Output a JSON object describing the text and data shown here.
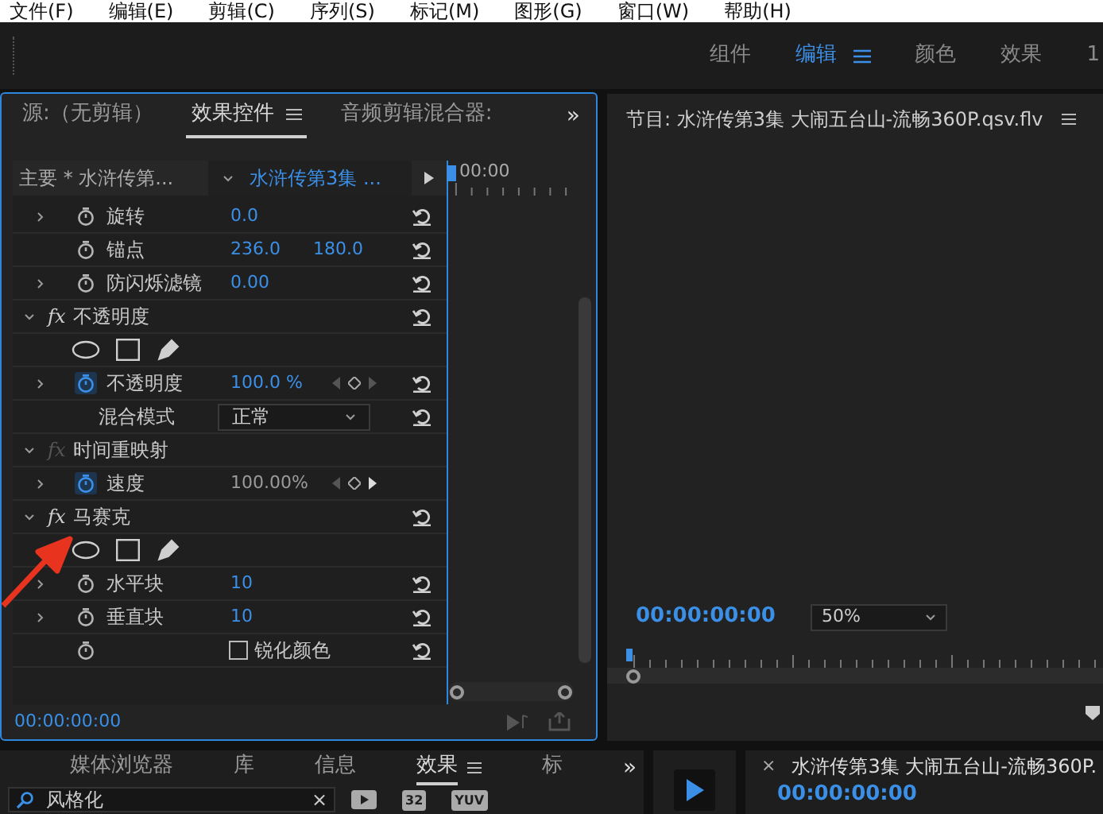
{
  "menu": [
    "文件(F)",
    "编辑(E)",
    "剪辑(C)",
    "序列(S)",
    "标记(M)",
    "图形(G)",
    "窗口(W)",
    "帮助(H)"
  ],
  "workspaces": [
    {
      "label": "组件",
      "selected": false
    },
    {
      "label": "编辑",
      "selected": true
    },
    {
      "label": "颜色",
      "selected": false
    },
    {
      "label": "效果",
      "selected": false
    },
    {
      "label": "1",
      "selected": false
    }
  ],
  "effect_controls": {
    "tabs": [
      {
        "label": "源:（无剪辑）",
        "selected": false
      },
      {
        "label": "效果控件",
        "selected": true
      },
      {
        "label": "音频剪辑混合器:",
        "selected": false
      }
    ],
    "overflow": "»",
    "master_clip": "主要 * 水浒传第...",
    "sequence_clip": "水浒传第3集 ...",
    "ruler_time": "00:00",
    "rows": [
      {
        "kind": "param",
        "label": "旋转",
        "expandable": true,
        "animated": false,
        "values": [
          "0.0"
        ],
        "editable": true,
        "keyframes": false,
        "reset": true
      },
      {
        "kind": "param",
        "label": "锚点",
        "expandable": false,
        "animated": false,
        "values": [
          "236.0",
          "180.0"
        ],
        "editable": true,
        "keyframes": false,
        "reset": true
      },
      {
        "kind": "param",
        "label": "防闪烁滤镜",
        "expandable": true,
        "animated": false,
        "values": [
          "0.00"
        ],
        "editable": true,
        "keyframes": false,
        "reset": true
      },
      {
        "kind": "section",
        "badge": "fx",
        "label": "不透明度",
        "fx_enabled": true,
        "reset": true
      },
      {
        "kind": "mask_tools"
      },
      {
        "kind": "param",
        "label": "不透明度",
        "expandable": true,
        "animated": true,
        "values": [
          "100.0 %"
        ],
        "editable": true,
        "keyframes": true,
        "reset": true
      },
      {
        "kind": "dropdown",
        "label": "混合模式",
        "value": "正常",
        "reset": true
      },
      {
        "kind": "section",
        "badge": "fx",
        "label": "时间重映射",
        "fx_enabled": false,
        "reset": false
      },
      {
        "kind": "param",
        "label": "速度",
        "expandable": true,
        "animated": true,
        "values": [
          "100.00%"
        ],
        "editable": false,
        "keyframes": true,
        "reset": false
      },
      {
        "kind": "section",
        "badge": "fx",
        "label": "马赛克",
        "fx_enabled": true,
        "reset": true
      },
      {
        "kind": "mask_tools"
      },
      {
        "kind": "param",
        "label": "水平块",
        "expandable": true,
        "animated": false,
        "values": [
          "10"
        ],
        "editable": true,
        "keyframes": false,
        "reset": true
      },
      {
        "kind": "param",
        "label": "垂直块",
        "expandable": true,
        "animated": false,
        "values": [
          "10"
        ],
        "editable": true,
        "keyframes": false,
        "reset": true
      },
      {
        "kind": "checkbox",
        "label": "锐化颜色",
        "checked": false,
        "reset": true
      }
    ],
    "timecode": "00:00:00:00"
  },
  "program": {
    "title": "节目: 水浒传第3集 大闹五台山-流畅360P.qsv.flv",
    "timecode": "00:00:00:00",
    "zoom": "50%"
  },
  "effects_panel": {
    "tabs": [
      {
        "label": "媒体浏览器",
        "selected": false
      },
      {
        "label": "库",
        "selected": false
      },
      {
        "label": "信息",
        "selected": false
      },
      {
        "label": "效果",
        "selected": true
      },
      {
        "label": "标",
        "selected": false
      }
    ],
    "overflow": "»",
    "search": "风格化",
    "clear": "×",
    "badges": [
      "32",
      "YUV"
    ]
  },
  "timeline": {
    "close": "×",
    "title": "水浒传第3集 大闹五台山-流畅360P.",
    "timecode": "00:00:00:00"
  }
}
